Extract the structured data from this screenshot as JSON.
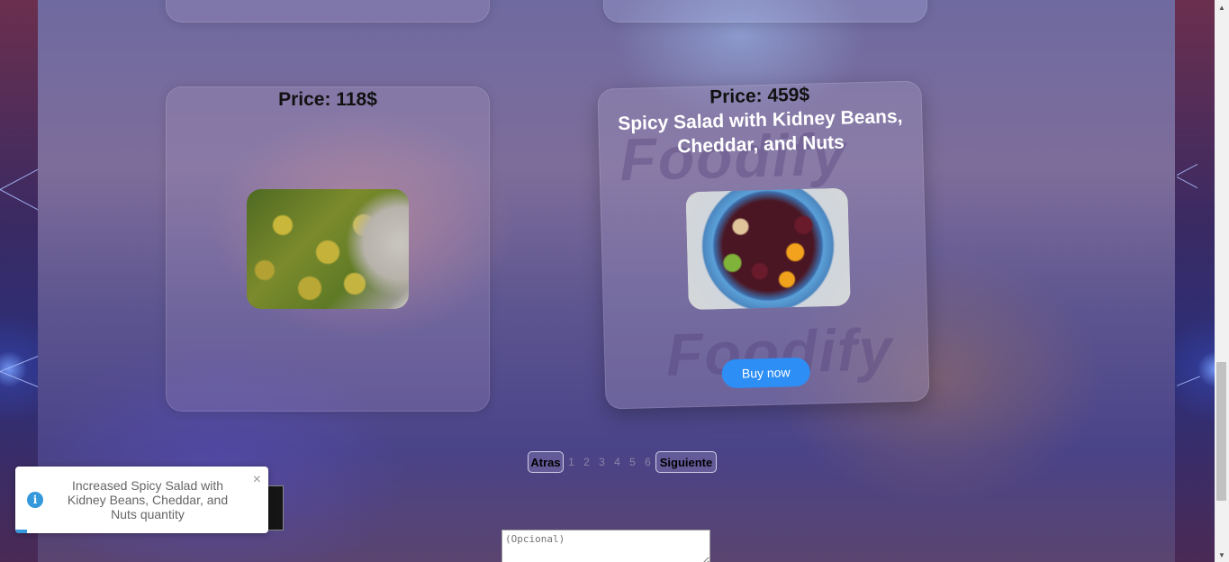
{
  "products": [
    {
      "price": "Price: 118$",
      "title": "",
      "image": "potato-dill-dish"
    },
    {
      "price": "Price: 459$",
      "title": "Spicy Salad with Kidney Beans, Cheddar, and Nuts",
      "image": "bean-salad",
      "watermark": "Foodify",
      "buy_label": "Buy now"
    }
  ],
  "pagination": {
    "prev_label": "Atras",
    "pages": [
      "1",
      "2",
      "3",
      "4",
      "5",
      "6"
    ],
    "next_label": "Siguiente"
  },
  "toast": {
    "icon": "info-icon",
    "message": "Increased Spicy Salad with Kidney Beans, Cheddar, and Nuts quantity",
    "close": "×"
  },
  "notes_field": {
    "placeholder": "(Opcional)"
  },
  "colors": {
    "buy_button": "#2d8ef5",
    "toast_accent": "#3498db"
  }
}
